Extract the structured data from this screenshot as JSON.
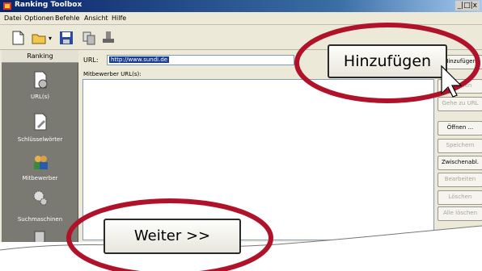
{
  "window": {
    "title": "Ranking Toolbox",
    "controls": "_|□|x"
  },
  "menu": [
    "Datei",
    "Optionen",
    "Befehle",
    "Ansicht",
    "Hilfe"
  ],
  "sidebar": {
    "header": "Ranking",
    "items": [
      {
        "label": "URL(s)",
        "icon": "document-globe-icon"
      },
      {
        "label": "Schlüsselwörter",
        "icon": "document-pen-icon"
      },
      {
        "label": "Mitbewerber",
        "icon": "people-icon"
      },
      {
        "label": "Suchmaschinen",
        "icon": "gears-icon"
      }
    ]
  },
  "main": {
    "url_label": "URL:",
    "url_value": "http://www.sundi.de",
    "competitors_label": "Mitbewerber URL(s):"
  },
  "buttons": {
    "add": "Hinzufügen",
    "next": "Weiter >>",
    "right": [
      {
        "label": "Hinzufügen",
        "enabled": true
      },
      {
        "label": "Löschen",
        "enabled": false
      },
      {
        "label": "Gehe zu URL",
        "enabled": false
      },
      {
        "label": "Öffnen ...",
        "enabled": true
      },
      {
        "label": "Speichern",
        "enabled": false
      },
      {
        "label": "Zwischenabl.",
        "enabled": true
      },
      {
        "label": "Bearbeiten",
        "enabled": false
      },
      {
        "label": "Löschen",
        "enabled": false
      },
      {
        "label": "Alle löschen",
        "enabled": false
      }
    ]
  },
  "colors": {
    "highlight_ellipse": "#b0122a",
    "title_bar": "#0a246a",
    "sidebar": "#7a7a72"
  }
}
